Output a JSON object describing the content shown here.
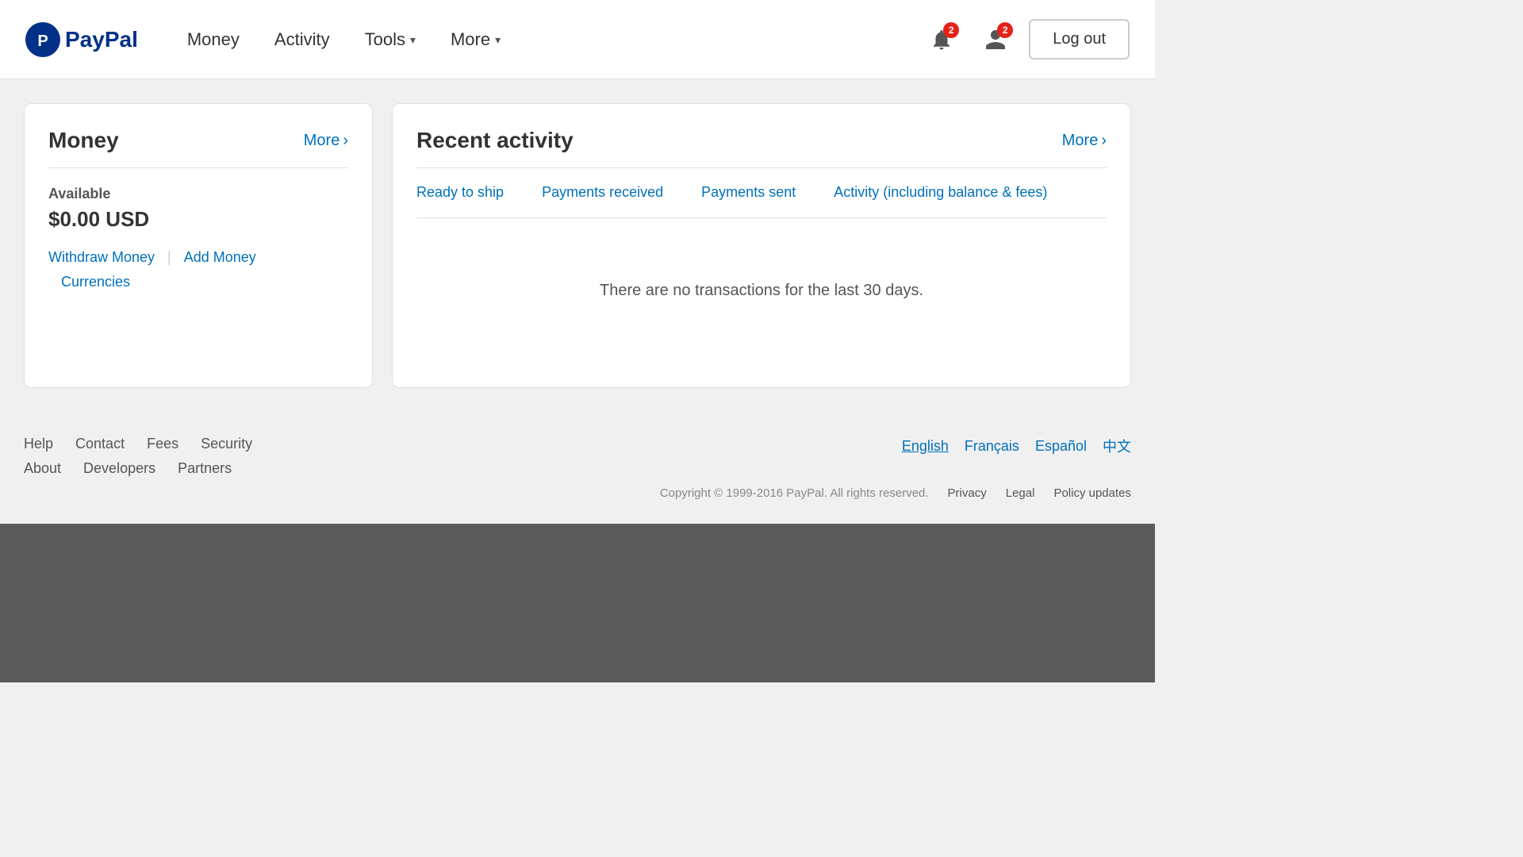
{
  "header": {
    "logo_text": "PayPal",
    "nav": [
      {
        "label": "Money",
        "has_dropdown": false
      },
      {
        "label": "Activity",
        "has_dropdown": false
      },
      {
        "label": "Tools",
        "has_dropdown": true
      },
      {
        "label": "More",
        "has_dropdown": true
      }
    ],
    "notification_count": "2",
    "logout_label": "Log out"
  },
  "money_card": {
    "title": "Money",
    "more_label": "More",
    "available_label": "Available",
    "balance": "$0.00 USD",
    "actions": {
      "withdraw": "Withdraw Money",
      "add": "Add Money",
      "currencies": "Currencies"
    }
  },
  "activity_card": {
    "title": "Recent activity",
    "more_label": "More",
    "tabs": [
      {
        "label": "Ready to ship"
      },
      {
        "label": "Payments received"
      },
      {
        "label": "Payments sent"
      },
      {
        "label": "Activity (including balance & fees)"
      }
    ],
    "empty_message": "There are no transactions for the last 30 days."
  },
  "footer": {
    "links_row1": [
      {
        "label": "Help"
      },
      {
        "label": "Contact"
      },
      {
        "label": "Fees"
      },
      {
        "label": "Security"
      }
    ],
    "links_row2": [
      {
        "label": "About"
      },
      {
        "label": "Developers"
      },
      {
        "label": "Partners"
      }
    ],
    "languages": [
      {
        "label": "English",
        "active": true
      },
      {
        "label": "Français",
        "active": false
      },
      {
        "label": "Español",
        "active": false
      },
      {
        "label": "中文",
        "active": false
      }
    ],
    "copyright": "Copyright © 1999-2016 PayPal. All rights reserved.",
    "copy_links": [
      {
        "label": "Privacy"
      },
      {
        "label": "Legal"
      },
      {
        "label": "Policy updates"
      }
    ]
  }
}
